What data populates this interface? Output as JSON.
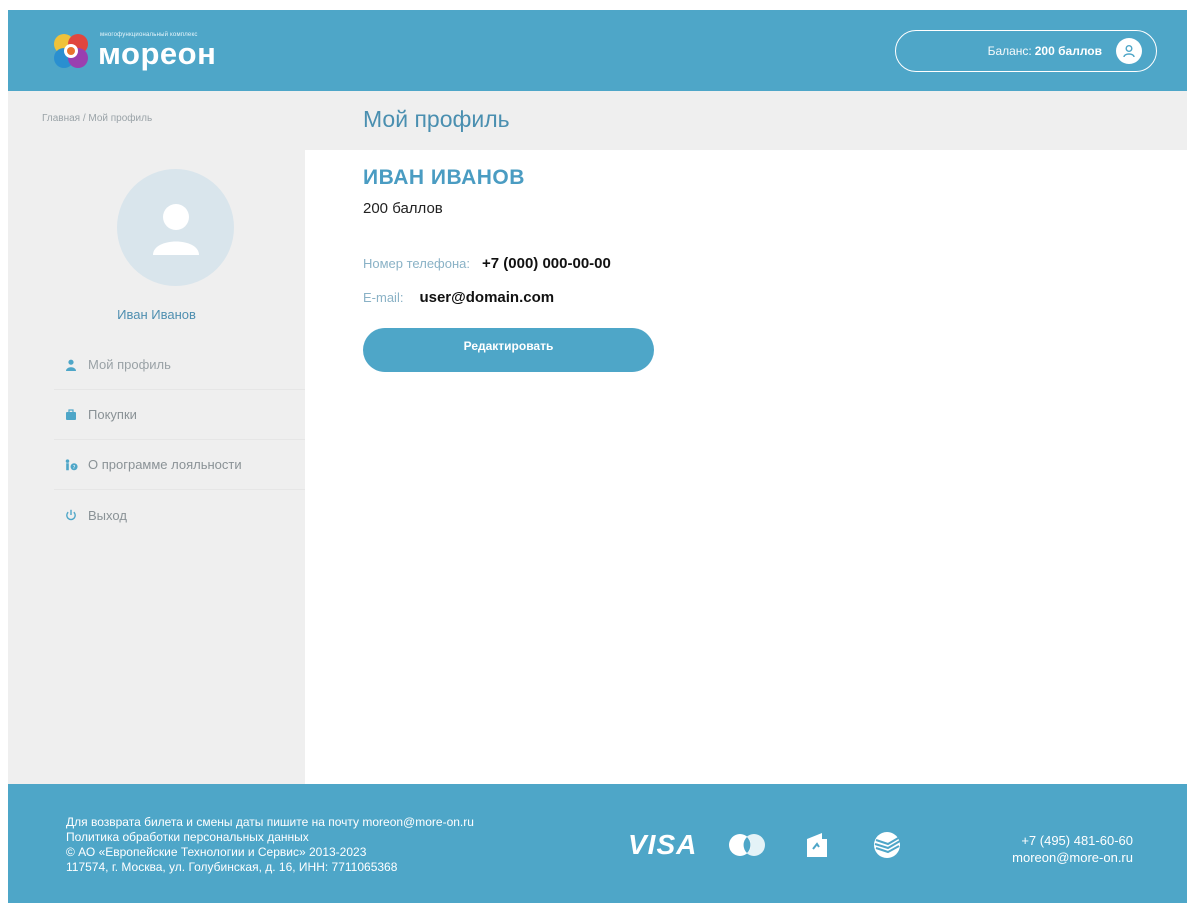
{
  "header": {
    "logo_subtitle": "многофункциональный комплекс",
    "logo_name": "мореон",
    "balance_label": "Баланс:",
    "balance_value": "200 баллов"
  },
  "titlebar": {
    "breadcrumb": "Главная / Мой профиль",
    "page_title": "Мой профиль"
  },
  "sidebar": {
    "user_name": "Иван Иванов",
    "menu": [
      {
        "label": "Мой профиль",
        "icon": "person-icon"
      },
      {
        "label": "Покупки",
        "icon": "bag-icon"
      },
      {
        "label": "О программе лояльности",
        "icon": "loyalty-icon"
      },
      {
        "label": "Выход",
        "icon": "power-icon"
      }
    ]
  },
  "profile": {
    "full_name": "ИВАН ИВАНОВ",
    "points": "200 баллов",
    "phone_label": "Номер телефона:",
    "phone_value": "+7 (000) 000-00-00",
    "email_label": "E-mail:",
    "email_value": "user@domain.com",
    "edit_button": "Редактировать"
  },
  "footer": {
    "lines": [
      "Для возврата билета и смены даты пишите на почту moreon@more-on.ru",
      "Политика обработки персональных данных",
      "© АО «Европейские Технологии и Сервис» 2013-2023",
      "117574, г. Москва, ул. Голубинская, д. 16, ИНН: 7711065368"
    ],
    "payment": {
      "visa": "VISA"
    },
    "phone": "+7 (495) 481-60-60",
    "email": "moreon@more-on.ru"
  },
  "colors": {
    "accent": "#4ea6c8",
    "title": "#4a8fb0",
    "panel": "#efefef"
  }
}
